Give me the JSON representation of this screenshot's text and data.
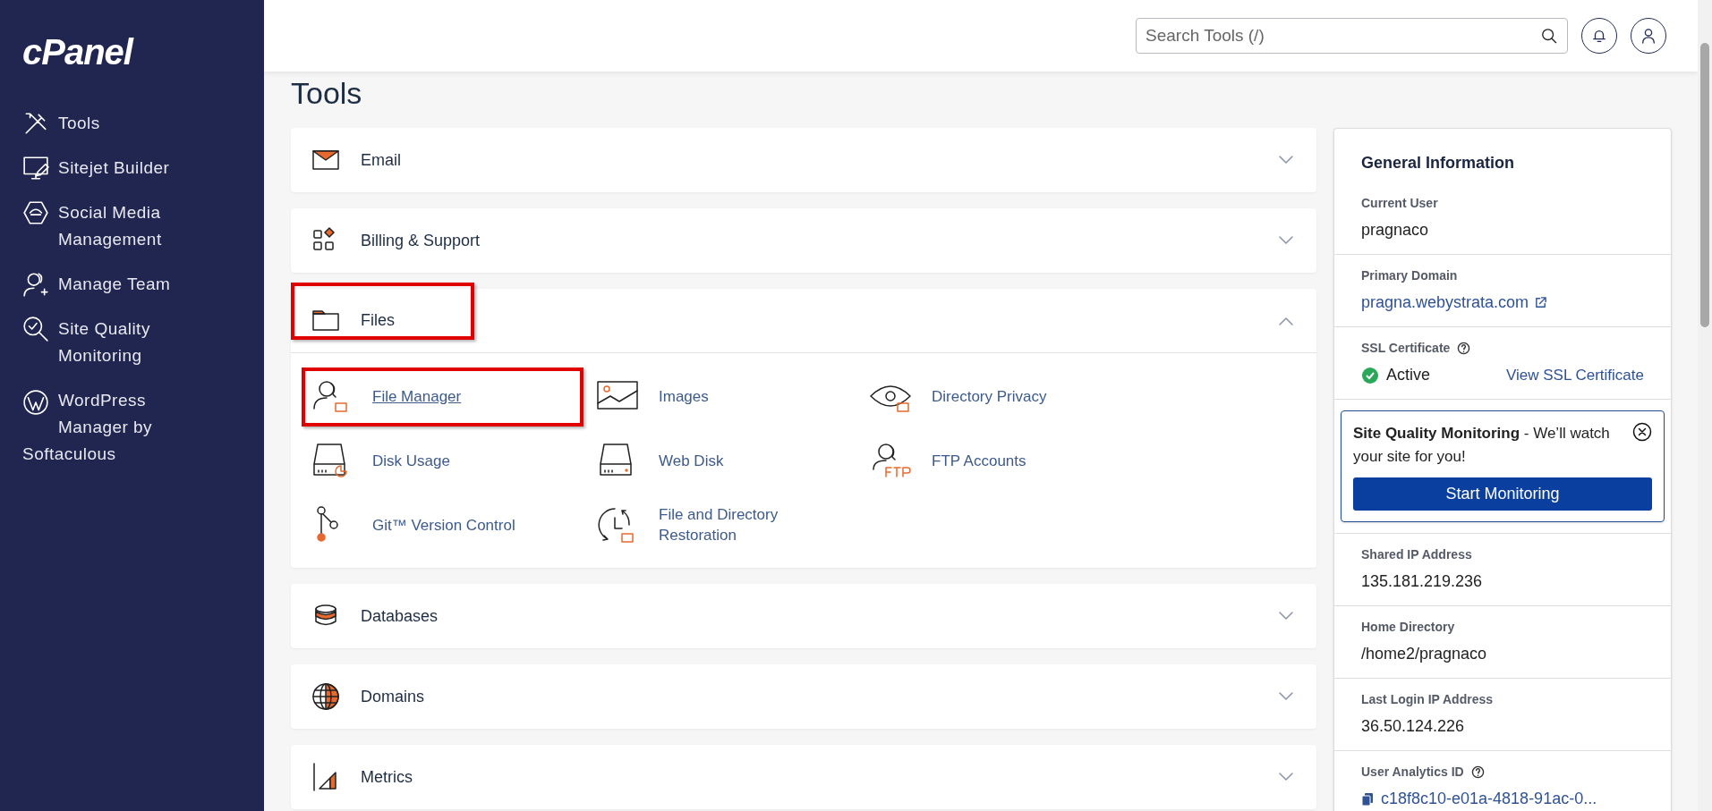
{
  "sidebar": {
    "logo": "cPanel",
    "items": [
      {
        "label": "Tools",
        "kind": "nav"
      },
      {
        "label": "Sitejet Builder",
        "kind": "nav"
      },
      {
        "label": "Social Media Management",
        "kind": "nav"
      },
      {
        "label": "Manage Team",
        "kind": "nav"
      },
      {
        "label": "Site Quality Monitoring",
        "kind": "nav"
      },
      {
        "label": "WordPress Manager by Softaculous",
        "kind": "wrap"
      }
    ]
  },
  "header": {
    "search": {
      "placeholder": "Search Tools (/)"
    }
  },
  "page_title": "Tools",
  "sections": [
    {
      "label": "Email",
      "expanded": false,
      "highlighted": false
    },
    {
      "label": "Billing & Support",
      "expanded": false,
      "highlighted": false
    },
    {
      "label": "Files",
      "expanded": true,
      "highlighted": true,
      "items": [
        {
          "label": "File Manager",
          "highlighted": true
        },
        {
          "label": "Images",
          "highlighted": false
        },
        {
          "label": "Directory Privacy",
          "highlighted": false
        },
        {
          "label": "Disk Usage",
          "highlighted": false
        },
        {
          "label": "Web Disk",
          "highlighted": false
        },
        {
          "label": "FTP Accounts",
          "highlighted": false
        },
        {
          "label": "Git™ Version Control",
          "highlighted": false
        },
        {
          "label": "File and Directory Restoration",
          "highlighted": false
        }
      ]
    },
    {
      "label": "Databases",
      "expanded": false,
      "highlighted": false
    },
    {
      "label": "Domains",
      "expanded": false,
      "highlighted": false
    },
    {
      "label": "Metrics",
      "expanded": false,
      "highlighted": false
    }
  ],
  "general_info": {
    "title": "General Information",
    "fields": [
      {
        "kind": "text",
        "label": "Current User",
        "help": false,
        "value": "pragnaco"
      },
      {
        "kind": "link",
        "label": "Primary Domain",
        "help": false,
        "value": "pragna.webystrata.com"
      },
      {
        "kind": "status",
        "label": "SSL Certificate",
        "help": true,
        "value": "Active",
        "link": "View SSL Certificate"
      },
      {
        "kind": "promo",
        "text": "**Site Quality Monitoring** - We’ll watch your site for you!",
        "button": "Start Monitoring"
      },
      {
        "kind": "text",
        "label": "Shared IP Address",
        "help": false,
        "value": "135.181.219.236"
      },
      {
        "kind": "text",
        "label": "Home Directory",
        "help": false,
        "value": "/home2/pragnaco"
      },
      {
        "kind": "text",
        "label": "Last Login IP Address",
        "help": false,
        "value": "36.50.124.226"
      },
      {
        "kind": "copy",
        "label": "User Analytics ID",
        "help": true,
        "value": "c18f8c10-e01a-4818-91ac-0..."
      }
    ]
  }
}
